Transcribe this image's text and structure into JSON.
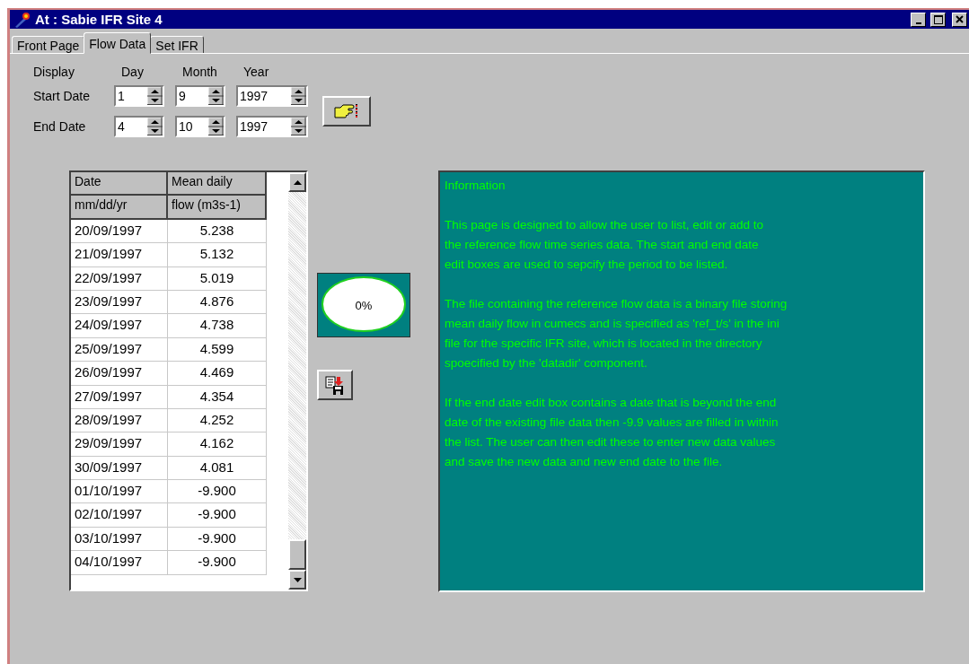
{
  "window": {
    "title": "At : Sabie IFR Site 4"
  },
  "tabs": [
    {
      "label": "Front Page",
      "selected": false
    },
    {
      "label": "Flow Data",
      "selected": true
    },
    {
      "label": "Set IFR",
      "selected": false
    }
  ],
  "date_form": {
    "headers": [
      "Display",
      "Day",
      "Month",
      "Year"
    ],
    "rows": [
      {
        "label": "Start Date",
        "day": "1",
        "month": "9",
        "year": "1997"
      },
      {
        "label": "End Date",
        "day": "4",
        "month": "10",
        "year": "1997"
      }
    ]
  },
  "table": {
    "header_rows": [
      [
        "Date",
        "Mean daily"
      ],
      [
        "mm/dd/yr",
        "flow (m3s-1)"
      ]
    ],
    "rows": [
      [
        "20/09/1997",
        "5.238"
      ],
      [
        "21/09/1997",
        "5.132"
      ],
      [
        "22/09/1997",
        "5.019"
      ],
      [
        "23/09/1997",
        "4.876"
      ],
      [
        "24/09/1997",
        "4.738"
      ],
      [
        "25/09/1997",
        "4.599"
      ],
      [
        "26/09/1997",
        "4.469"
      ],
      [
        "27/09/1997",
        "4.354"
      ],
      [
        "28/09/1997",
        "4.252"
      ],
      [
        "29/09/1997",
        "4.162"
      ],
      [
        "30/09/1997",
        "4.081"
      ],
      [
        "01/10/1997",
        "-9.900"
      ],
      [
        "02/10/1997",
        "-9.900"
      ],
      [
        "03/10/1997",
        "-9.900"
      ],
      [
        "04/10/1997",
        "-9.900"
      ]
    ]
  },
  "progress": {
    "reading": "0%"
  },
  "information": {
    "title": "Information",
    "paragraphs": [
      [
        "This page is designed to allow the user to list, edit or add to",
        "the reference flow time series data.  The start and end date",
        "edit boxes are used to sepcify the period to be listed."
      ],
      [
        "The file containing the reference flow data is a binary file storing",
        "mean daily flow in cumecs and is specified as 'ref_t/s' in the ini",
        "file for the specific IFR site, which is located in the directory",
        "spoecified by the 'datadir' component."
      ],
      [
        "If the end date edit box contains a date that is beyond the end",
        "date of the existing file data then -9.9 values are filled in within",
        "the list.  The user can then edit these to enter new data values",
        "and save the new data and new end date to the file."
      ]
    ]
  }
}
